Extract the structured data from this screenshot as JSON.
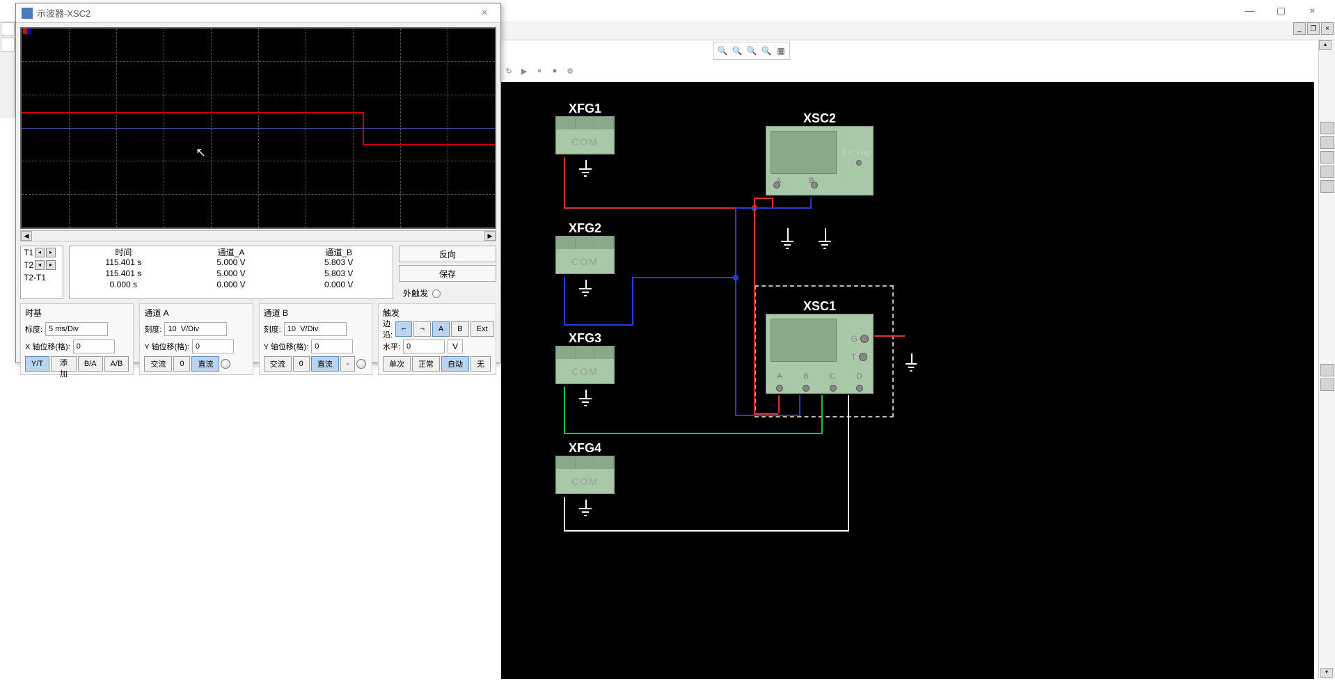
{
  "scope_window": {
    "title": "示波器-XSC2",
    "close": "×",
    "cursor_labels": {
      "t1": "T1",
      "t2": "T2",
      "diff": "T2-T1"
    },
    "readout": {
      "headers": {
        "time": "时间",
        "cha": "通道_A",
        "chb": "通道_B"
      },
      "rows": [
        {
          "time": "115.401 s",
          "cha": "5.000 V",
          "chb": "5.803 V"
        },
        {
          "time": "115.401 s",
          "cha": "5.000 V",
          "chb": "5.803 V"
        },
        {
          "time": "0.000 s",
          "cha": "0.000 V",
          "chb": "0.000 V"
        }
      ]
    },
    "actions": {
      "reverse": "反向",
      "save": "保存",
      "ext_trig": "外触发"
    },
    "timebase": {
      "title": "时基",
      "scale_label": "标度:",
      "scale_value": "5 ms/Div",
      "xoffset_label": "X 轴位移(格):",
      "xoffset_value": "0",
      "btn_yt": "Y/T",
      "btn_add": "添加",
      "btn_ba": "B/A",
      "btn_ab": "A/B"
    },
    "channel_a": {
      "title": "通道 A",
      "scale_label": "刻度:",
      "scale_value": "10  V/Div",
      "yoffset_label": "Y 轴位移(格):",
      "yoffset_value": "0",
      "btn_ac": "交流",
      "btn_zero": "0",
      "btn_dc": "直流"
    },
    "channel_b": {
      "title": "通道 B",
      "scale_label": "刻度:",
      "scale_value": "10  V/Div",
      "yoffset_label": "Y 轴位移(格):",
      "yoffset_value": "0",
      "btn_ac": "交流",
      "btn_zero": "0",
      "btn_dc": "直流",
      "btn_minus": "-"
    },
    "trigger": {
      "title": "触发",
      "edge_label": "边沿:",
      "btn_a": "A",
      "btn_b": "B",
      "btn_ext": "Ext",
      "level_label": "水平:",
      "level_value": "0",
      "level_unit": "V",
      "btn_single": "单次",
      "btn_normal": "正常",
      "btn_auto": "自动",
      "btn_none": "无"
    }
  },
  "circuit": {
    "xfg1": "XFG1",
    "xfg2": "XFG2",
    "xfg3": "XFG3",
    "xfg4": "XFG4",
    "xsc1": "XSC1",
    "xsc2": "XSC2",
    "com": "COM",
    "ext_trig": "Ext Trig",
    "ports2": {
      "a": "A",
      "b": "B"
    },
    "ports4": {
      "a": "A",
      "b": "B",
      "c": "C",
      "d": "D",
      "g": "G",
      "t": "T"
    }
  },
  "scroll_arrows": {
    "left": "◀",
    "right": "▶",
    "up": "▴",
    "down": "▾"
  }
}
